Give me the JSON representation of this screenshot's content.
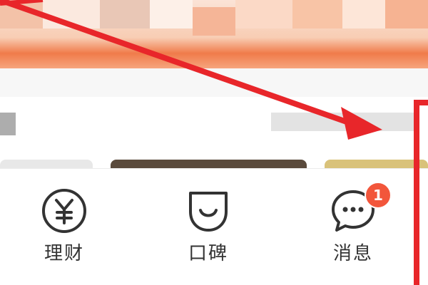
{
  "tabs": [
    {
      "label": "理财",
      "icon": "yuan-circle-icon"
    },
    {
      "label": "口碑",
      "icon": "koubei-smile-icon"
    },
    {
      "label": "消息",
      "icon": "message-bubble-icon",
      "badge": "1"
    }
  ],
  "colors": {
    "accent_orange": "#f07b4a",
    "annotation_red": "#e8262a",
    "badge_red": "#f2563b",
    "tab_text": "#333333"
  }
}
